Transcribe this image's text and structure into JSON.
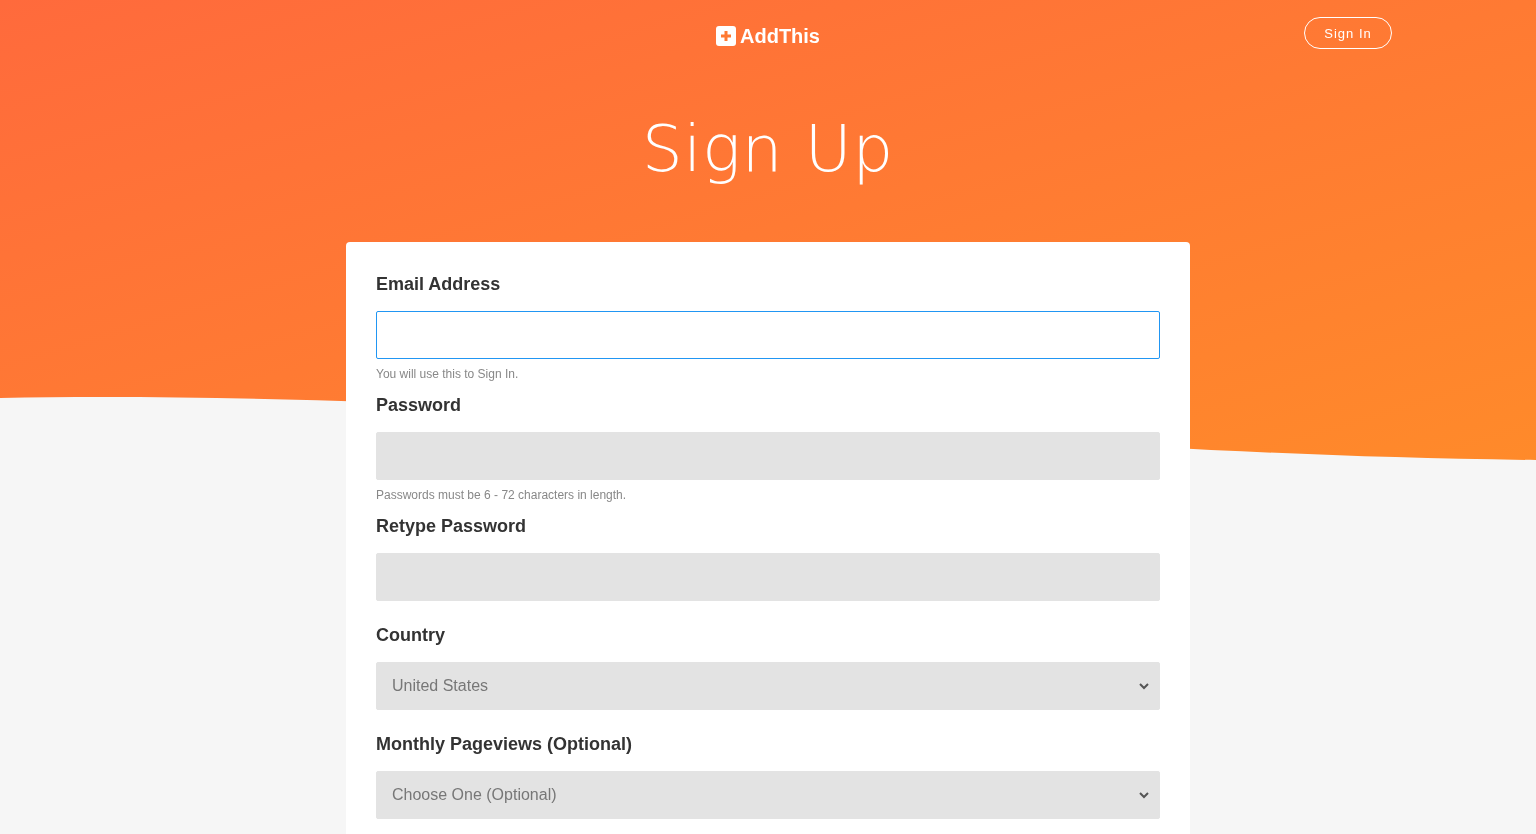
{
  "header": {
    "logo": "AddThis",
    "sign_in": "Sign In"
  },
  "title": "Sign Up",
  "fields": [
    {
      "kind": "text",
      "label": "Email Address",
      "focused": true,
      "help": "You will use this to Sign In."
    },
    {
      "kind": "password",
      "label": "Password",
      "focused": false,
      "help": "Passwords must be 6 - 72 characters in length."
    },
    {
      "kind": "password",
      "label": "Retype Password",
      "focused": false
    },
    {
      "kind": "select",
      "label": "Country",
      "focused": false,
      "value": "United States"
    },
    {
      "kind": "select",
      "label": "Monthly Pageviews (Optional)",
      "focused": false,
      "value": "Choose One (Optional)"
    }
  ]
}
